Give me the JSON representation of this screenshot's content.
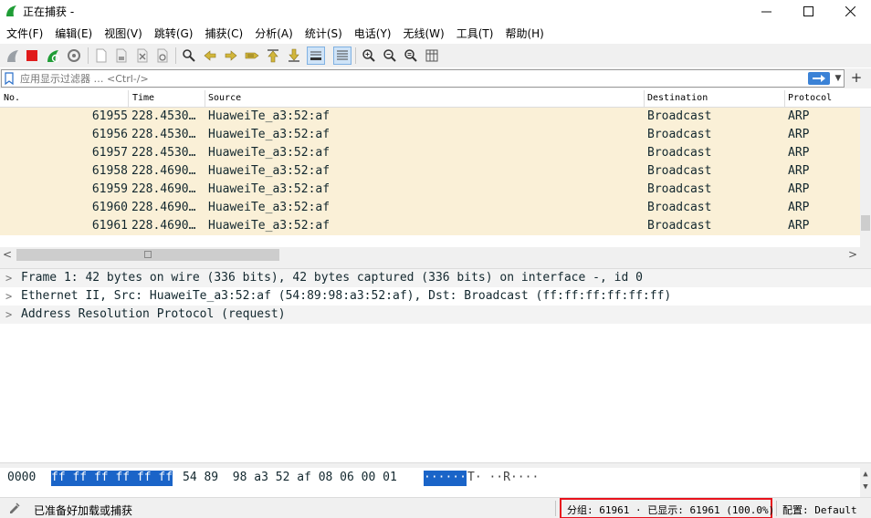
{
  "window": {
    "title": "正在捕获 -"
  },
  "menu": [
    "文件(F)",
    "编辑(E)",
    "视图(V)",
    "跳转(G)",
    "捕获(C)",
    "分析(A)",
    "统计(S)",
    "电话(Y)",
    "无线(W)",
    "工具(T)",
    "帮助(H)"
  ],
  "toolbar": {
    "icons": [
      "shark-fin-icon",
      "stop-capture-icon",
      "restart-capture-icon",
      "capture-options-icon",
      "open-file-icon",
      "save-file-icon",
      "close-file-icon",
      "reload-file-icon",
      "find-packet-icon",
      "go-back-icon",
      "go-forward-icon",
      "go-to-packet-icon",
      "go-first-icon",
      "go-last-icon",
      "auto-scroll-icon",
      "colorize-icon",
      "zoom-in-icon",
      "zoom-out-icon",
      "zoom-normal-icon",
      "resize-columns-icon"
    ]
  },
  "filter": {
    "placeholder": "应用显示过滤器 … <Ctrl-/>"
  },
  "packet_list": {
    "columns": {
      "no": "No.",
      "time": "Time",
      "source": "Source",
      "destination": "Destination",
      "protocol": "Protocol"
    },
    "rows": [
      {
        "no": "61955",
        "time": "228.4530…",
        "source": "HuaweiTe_a3:52:af",
        "destination": "Broadcast",
        "protocol": "ARP"
      },
      {
        "no": "61956",
        "time": "228.4530…",
        "source": "HuaweiTe_a3:52:af",
        "destination": "Broadcast",
        "protocol": "ARP"
      },
      {
        "no": "61957",
        "time": "228.4530…",
        "source": "HuaweiTe_a3:52:af",
        "destination": "Broadcast",
        "protocol": "ARP"
      },
      {
        "no": "61958",
        "time": "228.4690…",
        "source": "HuaweiTe_a3:52:af",
        "destination": "Broadcast",
        "protocol": "ARP"
      },
      {
        "no": "61959",
        "time": "228.4690…",
        "source": "HuaweiTe_a3:52:af",
        "destination": "Broadcast",
        "protocol": "ARP"
      },
      {
        "no": "61960",
        "time": "228.4690…",
        "source": "HuaweiTe_a3:52:af",
        "destination": "Broadcast",
        "protocol": "ARP"
      },
      {
        "no": "61961",
        "time": "228.4690…",
        "source": "HuaweiTe_a3:52:af",
        "destination": "Broadcast",
        "protocol": "ARP"
      }
    ]
  },
  "details": [
    "Frame 1: 42 bytes on wire (336 bits), 42 bytes captured (336 bits) on interface -, id 0",
    "Ethernet II, Src: HuaweiTe_a3:52:af (54:89:98:a3:52:af), Dst: Broadcast (ff:ff:ff:ff:ff:ff)",
    "Address Resolution Protocol (request)"
  ],
  "bytes": {
    "offset": "0000",
    "hex_highlighted": "ff ff ff ff ff ff",
    "hex_rest": "54 89  98 a3 52 af 08 06 00 01",
    "ascii_highlighted": "······",
    "ascii_rest": "T· ··R····"
  },
  "status": {
    "ready": "已准备好加载或捕获",
    "packets": "分组: 61961 · 已显示: 61961 (100.0%)",
    "profile": "配置: Default"
  },
  "colors": {
    "row_background": "#faf0d7",
    "selection": "#1a64c8",
    "highlight_border": "#e8121c"
  }
}
